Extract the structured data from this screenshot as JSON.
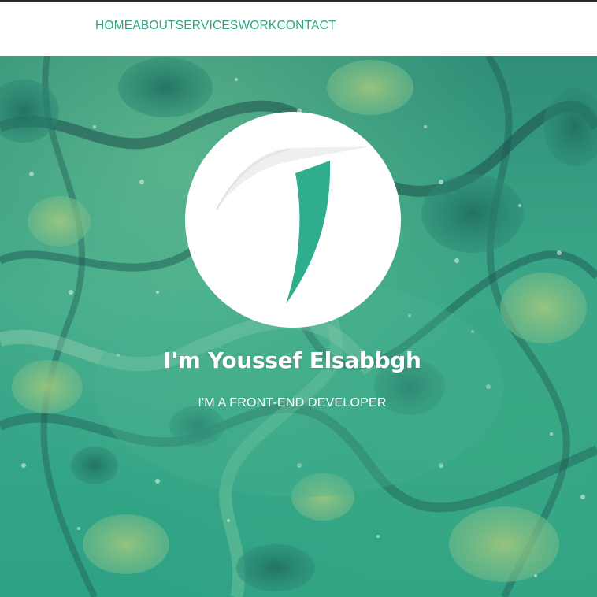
{
  "nav": {
    "items": [
      {
        "label": "HOME"
      },
      {
        "label": "ABOUT"
      },
      {
        "label": "SERVICES"
      },
      {
        "label": "WORK"
      },
      {
        "label": "CONTACT"
      }
    ]
  },
  "hero": {
    "title": "I'm Youssef Elsabbgh",
    "subtitle": "I'M A FRONT-END DEVELOPER",
    "logo_icon": "letter-t-logo-icon",
    "background": "green-marble-texture"
  },
  "colors": {
    "accent": "#2aa58a",
    "navbar_bg": "#ffffff",
    "hero_text": "#ffffff",
    "logo_teal": "#2fae8e",
    "logo_grey": "#eef0f0"
  }
}
